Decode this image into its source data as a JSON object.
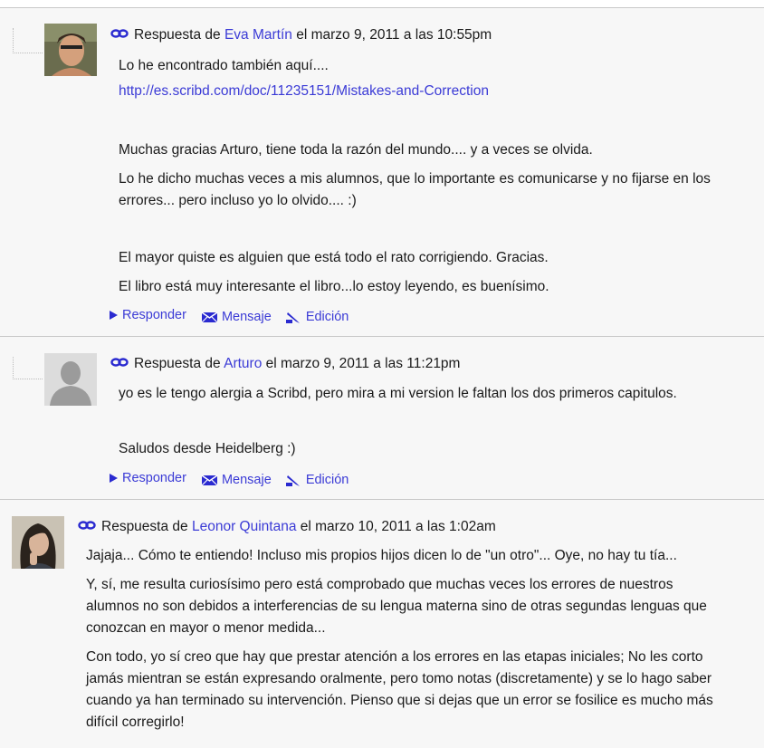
{
  "posts": [
    {
      "prefix": "Respuesta de",
      "author": "Eva Martín",
      "date_text": "el marzo 9, 2011 a las 10:55pm",
      "paragraphs": [
        "Lo he encontrado también aquí....",
        "Muchas gracias Arturo, tiene toda la razón del mundo.... y a veces se olvida.",
        "Lo he dicho muchas veces a mis alumnos, que lo importante es comunicarse y no fijarse en los errores... pero incluso yo lo olvido.... :)",
        "El mayor quiste es alguien que está todo el rato corrigiendo. Gracias.",
        "El libro está muy interesante el libro...lo estoy leyendo, es buenísimo."
      ],
      "link": "http://es.scribd.com/doc/11235151/Mistakes-and-Correction",
      "actions": {
        "reply": "Responder",
        "message": "Mensaje",
        "edit": "Edición"
      }
    },
    {
      "prefix": "Respuesta de",
      "author": "Arturo",
      "date_text": "el marzo 9, 2011 a las 11:21pm",
      "paragraphs": [
        "yo es le tengo alergia a Scribd, pero mira a mi version le faltan los dos primeros capitulos.",
        "Saludos desde Heidelberg :)"
      ],
      "actions": {
        "reply": "Responder",
        "message": "Mensaje",
        "edit": "Edición"
      }
    },
    {
      "prefix": "Respuesta de",
      "author": "Leonor Quintana",
      "date_text": "el marzo 10, 2011 a las 1:02am",
      "paragraphs": [
        "Jajaja... Cómo te entiendo! Incluso mis propios hijos dicen lo de \"un otro\"... Oye, no hay tu tía...",
        "Y, sí, me resulta curiosísimo pero está comprobado que muchas veces los errores de nuestros alumnos no son debidos a interferencias de su lengua materna sino de otras segundas lenguas que conozcan en mayor o menor medida...",
        "Con todo, yo sí creo que hay que prestar atención a los errores en las etapas iniciales; No les corto jamás mientran se están expresando oralmente, pero tomo notas (discretamente) y se lo hago saber cuando ya han terminado su intervención. Pienso que si dejas que un error se fosilice es mucho más difícil corregirlo!"
      ]
    }
  ],
  "icons": {
    "reply": "play-triangle-icon",
    "message": "envelope-icon",
    "edit": "pencil-icon",
    "permalink": "chain-link-icon"
  },
  "colors": {
    "link": "#3b3bd6",
    "text": "#1a1a1a",
    "background": "#f7f7f7",
    "divider": "#c8c8c8"
  }
}
